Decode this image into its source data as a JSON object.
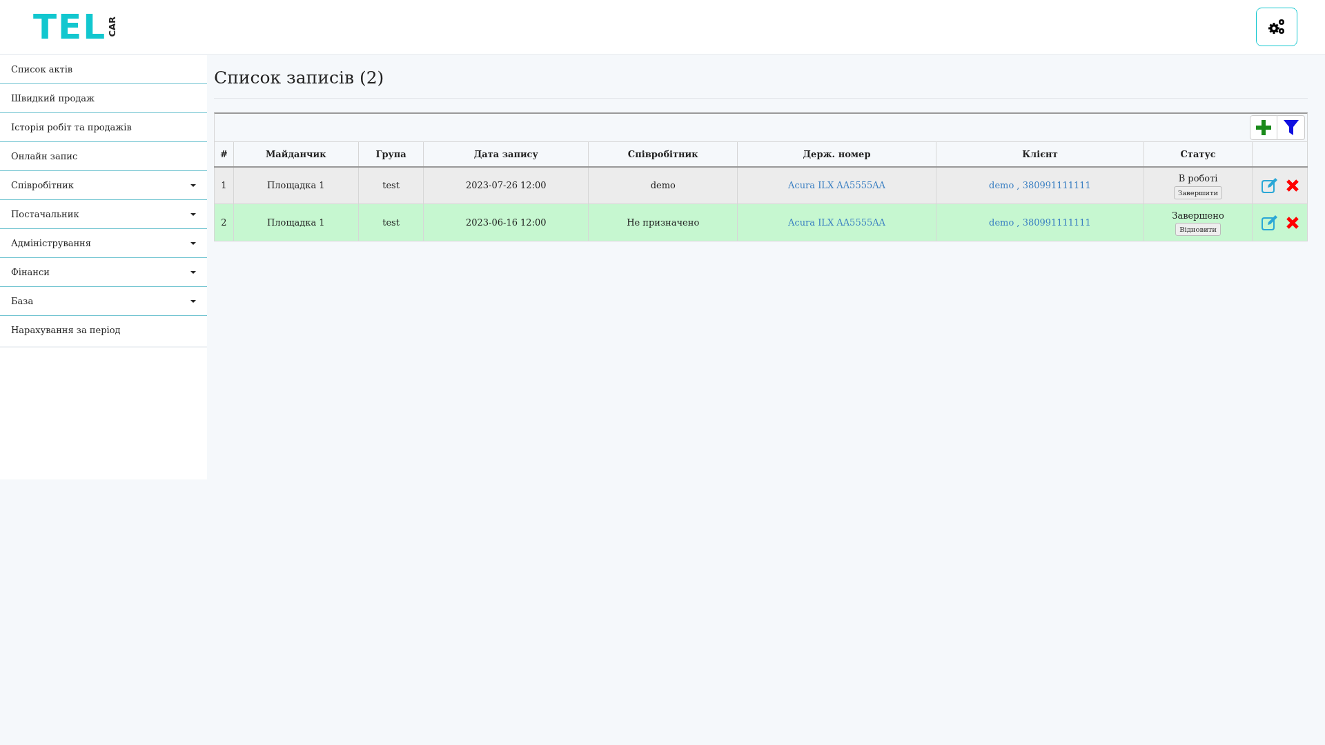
{
  "logo": {
    "main": "TEL",
    "side": "CAR"
  },
  "sidebar": {
    "items": [
      {
        "label": "Список актів",
        "kind": "link"
      },
      {
        "label": "Швидкий продаж",
        "kind": "link"
      },
      {
        "label": "Історія робіт та продажів",
        "kind": "link"
      },
      {
        "label": "Онлайн запис",
        "kind": "link"
      },
      {
        "label": "Співробітник",
        "kind": "dropdown"
      },
      {
        "label": "Постачальник",
        "kind": "dropdown"
      },
      {
        "label": "Адміністрування",
        "kind": "dropdown"
      },
      {
        "label": "Фінанси",
        "kind": "dropdown"
      },
      {
        "label": "База",
        "kind": "dropdown"
      },
      {
        "label": "Нарахування за період",
        "kind": "plain"
      }
    ]
  },
  "page_title": "Список записів (2)",
  "table": {
    "columns": [
      "#",
      "Майданчик",
      "Група",
      "Дата запису",
      "Співробітник",
      "Держ. номер",
      "Клієнт",
      "Статус"
    ],
    "rows": [
      {
        "kind": "in_progress",
        "number": "1",
        "site": "Площадка 1",
        "group": "test",
        "date": "2023-07-26 12:00",
        "employee": "demo",
        "plate": "Acura ILX AA5555AA",
        "client": "demo , 380991111111",
        "status": "В роботі",
        "status_action": "Завершити"
      },
      {
        "kind": "done",
        "number": "2",
        "site": "Площадка 1",
        "group": "test",
        "date": "2023-06-16 12:00",
        "employee": "Не призначено",
        "plate": "Acura ILX AA5555AA",
        "client": "demo , 380991111111",
        "status": "Завершено",
        "status_action": "Відновити"
      }
    ]
  }
}
